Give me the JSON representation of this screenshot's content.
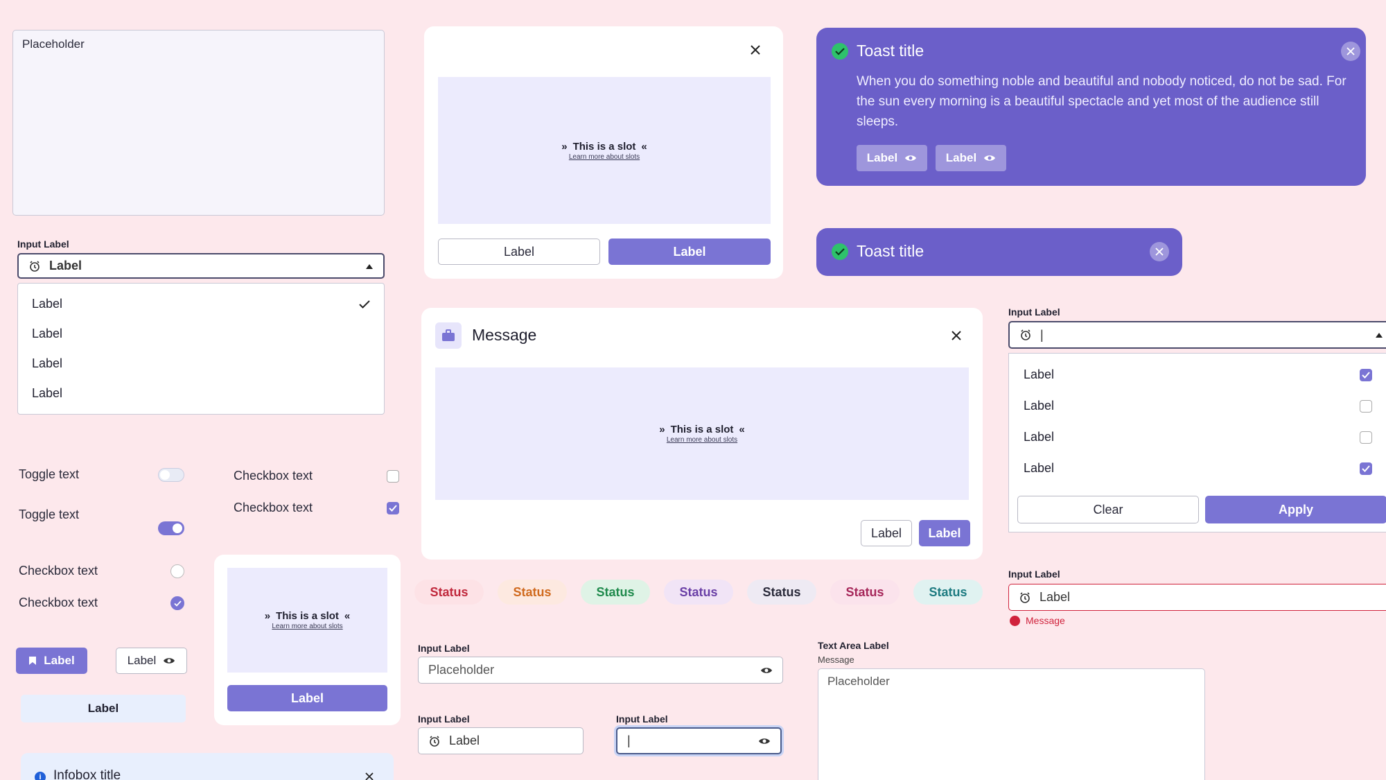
{
  "textarea_top": {
    "placeholder": "Placeholder"
  },
  "select_left": {
    "label": "Input Label",
    "value": "Label",
    "options": [
      "Label",
      "Label",
      "Label",
      "Label"
    ]
  },
  "modal_small": {
    "slot_title": "This is a slot",
    "slot_link": "Learn more about slots",
    "cancel_label": "Label",
    "confirm_label": "Label"
  },
  "toast_large": {
    "title": "Toast title",
    "body": "When you do something noble and beautiful and nobody noticed, do not be sad. For the sun every morning is a beautiful spectacle and yet most of the audience still sleeps.",
    "button1": "Label",
    "button2": "Label"
  },
  "toast_small": {
    "title": "Toast title"
  },
  "message_modal": {
    "title": "Message",
    "slot_title": "This is a slot",
    "slot_link": "Learn more about slots",
    "cancel_label": "Label",
    "confirm_label": "Label"
  },
  "multiselect": {
    "label": "Input Label",
    "value": "|",
    "options": [
      {
        "label": "Label",
        "checked": true
      },
      {
        "label": "Label",
        "checked": false
      },
      {
        "label": "Label",
        "checked": false
      },
      {
        "label": "Label",
        "checked": true
      }
    ],
    "clear_label": "Clear",
    "apply_label": "Apply"
  },
  "toggles": [
    {
      "text": "Toggle text",
      "on": false
    },
    {
      "text": "Toggle text",
      "on": true
    }
  ],
  "checkboxes": [
    {
      "text": "Checkbox text",
      "checked": false
    },
    {
      "text": "Checkbox text",
      "checked": true
    }
  ],
  "radios": [
    {
      "text": "Checkbox text",
      "checked": false
    },
    {
      "text": "Checkbox text",
      "checked": true
    }
  ],
  "buttons_left": {
    "primary": "Label",
    "outline": "Label",
    "ghost": "Label"
  },
  "slot_card": {
    "slot_title": "This is a slot",
    "slot_link": "Learn more about slots",
    "button": "Label"
  },
  "infobox": {
    "title": "Infobox title"
  },
  "statuses": [
    {
      "label": "Status",
      "color": "#c0283c",
      "bg": "#fde2e6"
    },
    {
      "label": "Status",
      "color": "#d06a1e",
      "bg": "#fde9e0"
    },
    {
      "label": "Status",
      "color": "#1f8a4c",
      "bg": "#dff3e6"
    },
    {
      "label": "Status",
      "color": "#6a3fa6",
      "bg": "#f1e4f6"
    },
    {
      "label": "Status",
      "color": "#2a2a3a",
      "bg": "#eeeaf3"
    },
    {
      "label": "Status",
      "color": "#a6275a",
      "bg": "#fbe3ec"
    },
    {
      "label": "Status",
      "color": "#1c7a80",
      "bg": "#e0f2f1"
    }
  ],
  "input_password": {
    "label": "Input Label",
    "placeholder": "Placeholder"
  },
  "input_icon": {
    "label": "Input Label",
    "value": "Label"
  },
  "input_focused": {
    "label": "Input Label",
    "value": "|"
  },
  "input_error": {
    "label": "Input Label",
    "value": "Label",
    "message": "Message"
  },
  "textarea_labeled": {
    "label": "Text Area Label",
    "sublabel": "Message",
    "placeholder": "Placeholder"
  },
  "colors": {
    "background": "#fde8ec",
    "primary": "#7a74d4",
    "toast": "#6b5fc9",
    "slot": "#ecebfd",
    "error": "#d0223c",
    "success": "#2ec26b"
  }
}
